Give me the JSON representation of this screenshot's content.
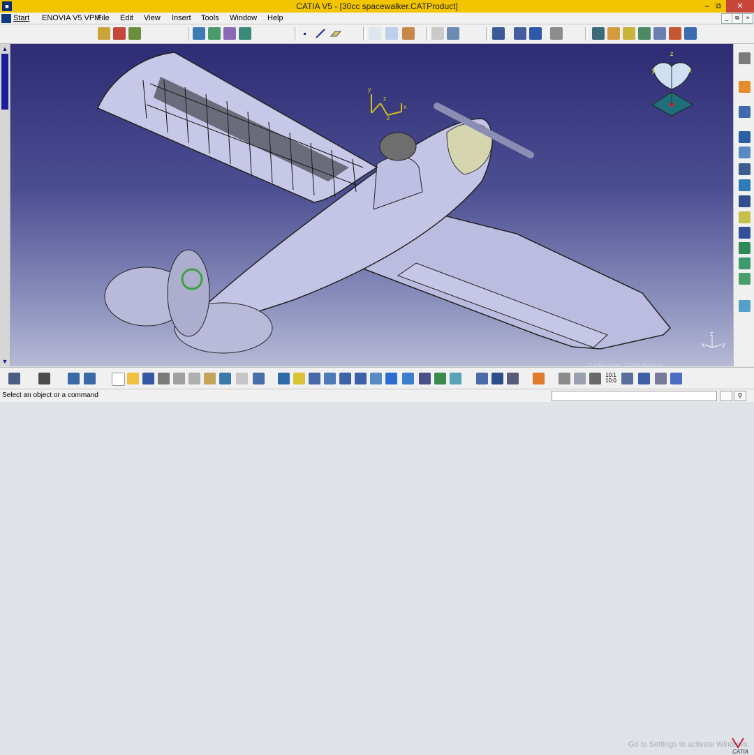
{
  "window": {
    "title": "CATIA V5 - [30cc spacewalker.CATProduct]",
    "minimize": "–",
    "restore": "⧉",
    "close": "✕"
  },
  "menubar": {
    "items": [
      "Start",
      "ENOVIA V5 VPM",
      "File",
      "Edit",
      "View",
      "Insert",
      "Tools",
      "Window",
      "Help"
    ],
    "mdi": [
      "_",
      "⧉",
      "×"
    ]
  },
  "compass": {
    "z": "z",
    "x": "x",
    "y": "y"
  },
  "axis_system": {
    "x": "x",
    "y": "y",
    "z": "z"
  },
  "local_axes": {
    "y1": "y",
    "z1": "z",
    "x1": "x",
    "z2": "z"
  },
  "bottom_toolbar": {
    "zoom_ratio_top": "10:1",
    "zoom_ratio_bottom": "10:0"
  },
  "watermark": {
    "line1": "Activate Windows",
    "line2": "Go to Settings to activate Windows."
  },
  "logo_text": "CATIA",
  "status": {
    "message": "Select an object or a command",
    "command_value": ""
  }
}
